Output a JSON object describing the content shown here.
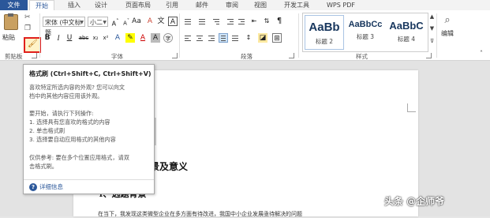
{
  "tabs": [
    "文件",
    "开始",
    "插入",
    "设计",
    "页面布局",
    "引用",
    "邮件",
    "审阅",
    "视图",
    "开发工具",
    "WPS PDF"
  ],
  "clipboard": {
    "paste_label": "粘贴",
    "group_label": "剪贴板"
  },
  "font": {
    "name": "宋体 (中文标题",
    "size": "小二",
    "group_label": "字体",
    "bold": "B",
    "italic": "I",
    "underline": "U",
    "strike": "abc",
    "font_color_letter": "A"
  },
  "paragraph": {
    "group_label": "段落"
  },
  "styles": {
    "group_label": "样式",
    "items": [
      {
        "sample": "AaBb",
        "name": "标题 2"
      },
      {
        "sample": "AaBbCc",
        "name": "标题 3"
      },
      {
        "sample": "AaBbC",
        "name": "标题 4"
      }
    ]
  },
  "editing": {
    "label": "编辑"
  },
  "tooltip": {
    "title": "格式刷 (Ctrl+Shift+C, Ctrl+Shift+V)",
    "desc1": "喜欢特定所选内容的外观? 您可以向文",
    "desc2": "档中的其他内容应用该外观。",
    "start": "要开始，请执行下列操作:",
    "step1": "1. 选择具有您喜欢的格式的内容",
    "step2": "2. 单击格式刷",
    "step3": "3. 选择要自动应用格式的其他内容",
    "tip1": "仅供参考: 要在多个位置应用格式，请双",
    "tip2": "击格式刷。",
    "help": "详细信息"
  },
  "document": {
    "heading1": "背景及意义",
    "heading2": "1、选题背景",
    "body_fragment": "在当下，我发现这类微型企业在多方面有待改进，我国中小企业发展亟待解决的问题"
  },
  "watermark": "头条 @企师爷",
  "colors": {
    "file_tab": "#2b579a",
    "highlight_border": "#e0201c"
  }
}
